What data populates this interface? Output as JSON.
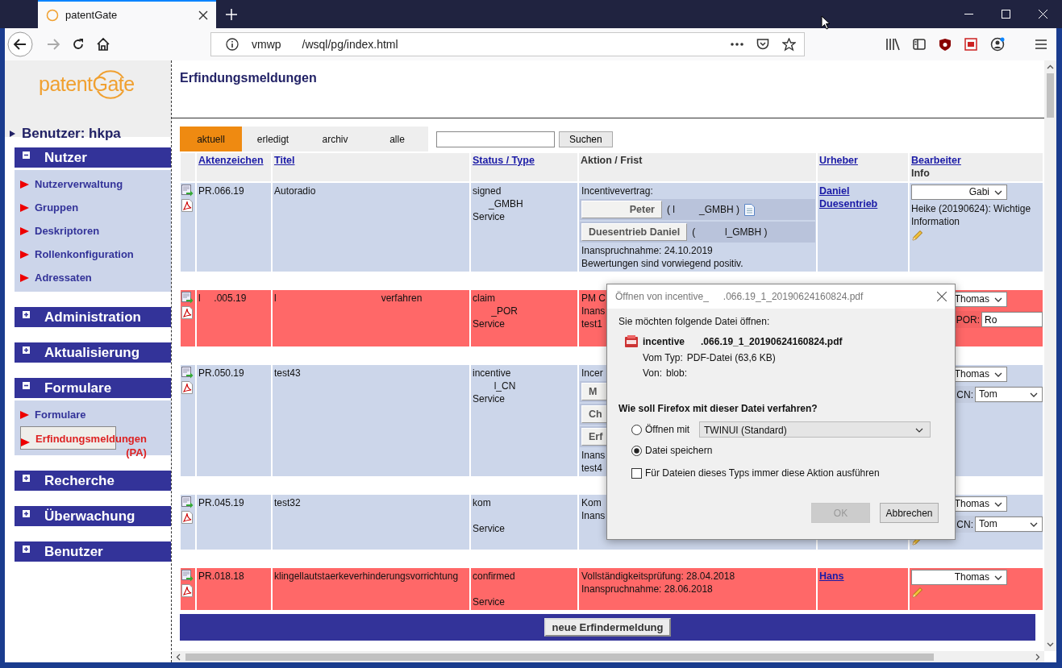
{
  "browser": {
    "tabs": [
      {
        "title": "patentGate",
        "selected": true
      }
    ],
    "url": {
      "host": "vmwp",
      "path": "/wsql/pg/index.html"
    }
  },
  "sidebar": {
    "logo": "patentGate",
    "user": "Benutzer: hkpa",
    "sections": [
      {
        "title": "Nutzer",
        "expanded": true,
        "items": [
          {
            "label": "Nutzerverwaltung",
            "selected": false
          },
          {
            "label": "Gruppen",
            "selected": false
          },
          {
            "label": "Deskriptoren",
            "selected": false
          },
          {
            "label": "Rollenkonfiguration",
            "selected": false
          },
          {
            "label": "Adressaten",
            "selected": false
          }
        ]
      },
      {
        "title": "Administration",
        "expanded": false
      },
      {
        "title": "Aktualisierung",
        "expanded": false
      },
      {
        "title": "Formulare",
        "expanded": true,
        "items": [
          {
            "label": "Formulare",
            "selected": false
          },
          {
            "label": "Erfindungsmeldungen (PA)",
            "selected": true
          }
        ]
      },
      {
        "title": "Recherche",
        "expanded": false
      },
      {
        "title": "Überwachung",
        "expanded": false
      },
      {
        "title": "Benutzer",
        "expanded": false
      }
    ]
  },
  "main": {
    "title": "Erfindungsmeldungen",
    "tabs": [
      {
        "label": "aktuell",
        "selected": true
      },
      {
        "label": "erledigt",
        "selected": false
      },
      {
        "label": "archiv",
        "selected": false
      },
      {
        "label": "alle",
        "selected": false
      }
    ],
    "search_button": "Suchen",
    "table": {
      "columns": [
        {
          "label": "Aktenzeichen",
          "link": true
        },
        {
          "label": "Titel",
          "link": true
        },
        {
          "label": "Status / Type",
          "link": true
        },
        {
          "label": "Aktion / Frist",
          "link": false
        },
        {
          "label": "Urheber",
          "link": true
        },
        {
          "label": "Bearbeiter",
          "link": true,
          "sub": "Info"
        }
      ],
      "rows": [
        {
          "flagged": false,
          "aktenzeichen": "PR.066.19",
          "titel": "Autoradio",
          "status": {
            "type": "signed",
            "party": "      _GMBH",
            "dept": "Service"
          },
          "aktion": [
            {
              "kind": "text",
              "text": "Incentivevertrag:"
            },
            {
              "kind": "person",
              "button": "Peter",
              "company": "( l         _GMBH )",
              "doc": true
            },
            {
              "kind": "person",
              "button": "Duesentrieb Daniel",
              "company": "(           l_GMBH )",
              "doc": false
            },
            {
              "kind": "text",
              "text": "Inanspruchnahme: 24.10.2019"
            },
            {
              "kind": "text",
              "text": "Bewertungen sind vorwiegend positiv."
            }
          ],
          "urheber": [
            "Daniel",
            "Duesentrieb"
          ],
          "bearbeiter": {
            "select": "Gabi",
            "info": "Heike (20190624): Wichtige Information",
            "pencil": true
          }
        },
        {
          "flagged": true,
          "aktenzeichen": "l     .005.19",
          "titel": "l                                       verfahren",
          "status": {
            "type": "claim",
            "party": "       _POR",
            "dept": "Service"
          },
          "aktion": [
            {
              "kind": "text",
              "text": "PM C"
            },
            {
              "kind": "text",
              "text": "Inans"
            },
            {
              "kind": "text",
              "text": "test1"
            }
          ],
          "bearbeiter": {
            "select": "Thomas",
            "extra": {
              "label": "POR:",
              "input": "Ro"
            },
            "pencil": false
          }
        },
        {
          "flagged": false,
          "aktenzeichen": "PR.050.19",
          "titel": "test43",
          "status": {
            "type": "incentive",
            "party": "        l_CN",
            "dept": "Service"
          },
          "aktion": [
            {
              "kind": "text",
              "text": "Incer"
            },
            {
              "kind": "button",
              "button": "M"
            },
            {
              "kind": "button",
              "button": "Ch"
            },
            {
              "kind": "button",
              "button": "Erf"
            },
            {
              "kind": "text",
              "text": "Inans"
            },
            {
              "kind": "text",
              "text": "test4"
            }
          ],
          "bearbeiter": {
            "select": "Thomas",
            "extra": {
              "label": "CN:",
              "select": "Tom"
            },
            "pencil": false
          }
        },
        {
          "flagged": false,
          "aktenzeichen": "PR.045.19",
          "titel": "test32",
          "status": {
            "type": "kom",
            "dept": "Service"
          },
          "aktion": [
            {
              "kind": "text",
              "text": "Kom"
            },
            {
              "kind": "text",
              "text": "Inans"
            }
          ],
          "bearbeiter": {
            "select": "Thomas",
            "extra": {
              "label": "CN:",
              "select": "Tom"
            },
            "pencil": true
          }
        },
        {
          "flagged": true,
          "aktenzeichen": "PR.018.18",
          "titel": "klingellautstaerkeverhinderungsvorrichtung",
          "status": {
            "type": "confirmed",
            "dept": "Service"
          },
          "aktion": [
            {
              "kind": "text",
              "text": "Vollständigkeitsprüfung: 28.04.2018"
            },
            {
              "kind": "text",
              "text": "Inanspruchnahme: 28.06.2018"
            }
          ],
          "urheber": [
            "Hans"
          ],
          "bearbeiter": {
            "select": "Thomas",
            "pencil": true
          }
        }
      ]
    },
    "new_button": "neue Erfindermeldung"
  },
  "dialog": {
    "title": [
      "Öffnen von incentive_",
      ".066.19_1_20190624160824.pdf"
    ],
    "prompt": "Sie möchten folgende Datei öffnen:",
    "file": [
      "incentive",
      ".066.19_1_20190624160824.pdf"
    ],
    "type_label": "Vom Typ:",
    "type": "PDF-Datei (63,6 KB)",
    "from_label": "Von:",
    "from": "blob:",
    "question": "Wie soll Firefox mit dieser Datei verfahren?",
    "options": [
      {
        "label": "Öffnen mit",
        "selected": false,
        "app": "TWINUI (Standard)"
      },
      {
        "label": "Datei speichern",
        "selected": true
      }
    ],
    "remember": {
      "label": "Für Dateien dieses Typs immer diese Aktion ausführen",
      "checked": false
    },
    "buttons": [
      {
        "label": "OK",
        "disabled": true
      },
      {
        "label": "Abbrechen",
        "disabled": false
      }
    ]
  }
}
